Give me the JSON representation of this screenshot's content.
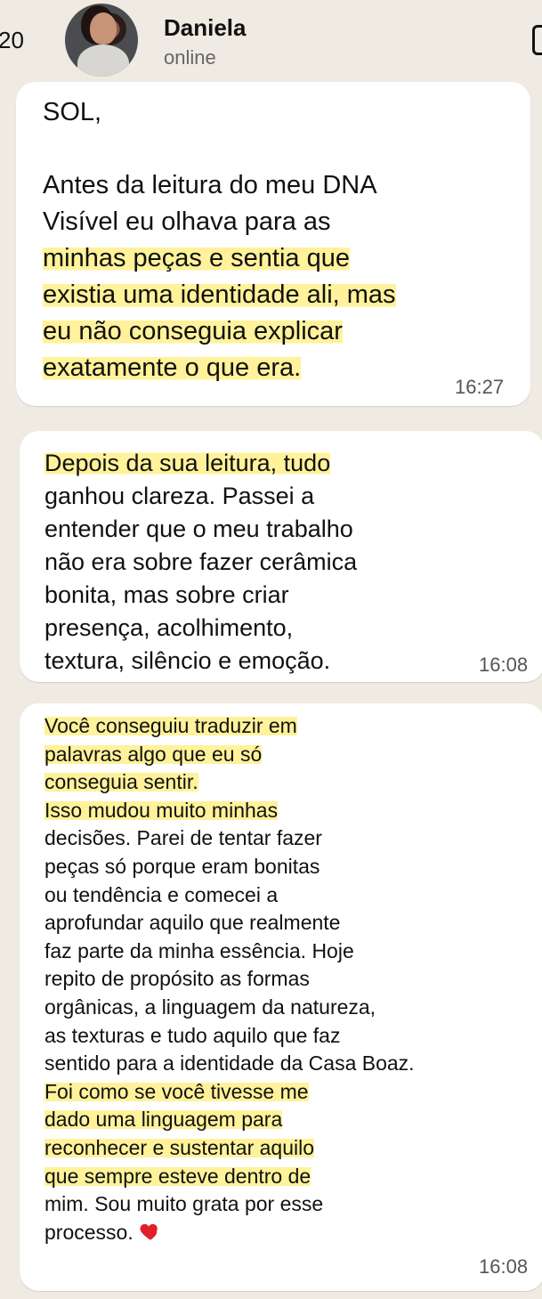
{
  "header": {
    "back_count": "20",
    "contact_name": "Daniela",
    "contact_status": "online"
  },
  "messages": [
    {
      "time": "16:27",
      "lines": [
        "SOL,",
        "",
        "Antes da leitura do meu DNA",
        "Visível eu olhava para as",
        "minhas peças e sentia que",
        "existia uma identidade ali, mas",
        "eu não conseguia explicar",
        "exatamente o que era."
      ]
    },
    {
      "time": "16:08",
      "lines": [
        "Depois da sua leitura, tudo",
        "ganhou clareza. Passei a",
        "entender que o meu trabalho",
        "não era sobre fazer cerâmica",
        "bonita, mas sobre criar",
        "presença, acolhimento,",
        "textura, silêncio e emoção."
      ]
    },
    {
      "time": "16:08",
      "lines": [
        "Você conseguiu traduzir em",
        "palavras algo que eu só",
        "conseguia sentir.",
        "Isso mudou muito minhas",
        "decisões. Parei de tentar fazer",
        "peças só porque eram bonitas",
        "ou tendência e comecei a",
        "aprofundar aquilo que realmente",
        "faz parte da minha essência. Hoje",
        "repito de propósito as formas",
        "orgânicas, a linguagem da natureza,",
        "as texturas e tudo aquilo que faz",
        "sentido para a identidade da Casa Boaz.",
        "Foi como se você tivesse me",
        "dado uma linguagem para",
        "reconhecer e sustentar aquilo",
        "que sempre esteve dentro de",
        "mim. Sou muito grata por esse",
        "processo."
      ],
      "emoji": "heart-icon"
    }
  ]
}
